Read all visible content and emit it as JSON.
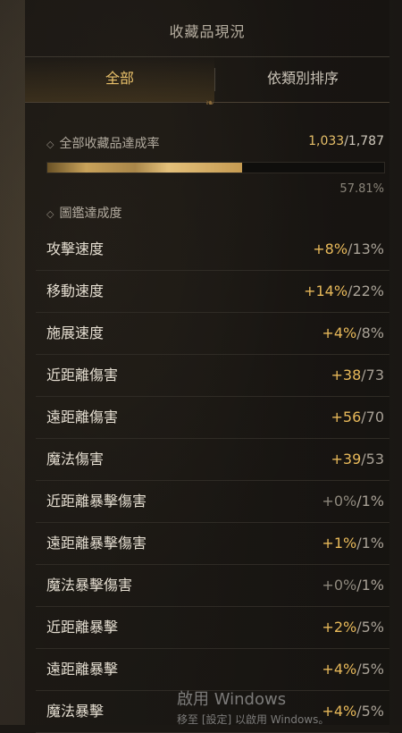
{
  "title": "收藏品現況",
  "tabs": [
    {
      "label": "全部",
      "active": true
    },
    {
      "label": "依類別排序",
      "active": false
    }
  ],
  "overall": {
    "label": "全部收藏品達成率",
    "current": "1,033",
    "total": "1,787",
    "percent_text": "57.81%",
    "percent": 57.81
  },
  "codex": {
    "label": "圖鑑達成度"
  },
  "stats": [
    {
      "name": "攻擊速度",
      "bonus": "+8%",
      "max": "13%"
    },
    {
      "name": "移動速度",
      "bonus": "+14%",
      "max": "22%"
    },
    {
      "name": "施展速度",
      "bonus": "+4%",
      "max": "8%"
    },
    {
      "name": "近距離傷害",
      "bonus": "+38",
      "max": "73"
    },
    {
      "name": "遠距離傷害",
      "bonus": "+56",
      "max": "70"
    },
    {
      "name": "魔法傷害",
      "bonus": "+39",
      "max": "53"
    },
    {
      "name": "近距離暴擊傷害",
      "bonus": "+0%",
      "max": "1%",
      "zero": true
    },
    {
      "name": "遠距離暴擊傷害",
      "bonus": "+1%",
      "max": "1%"
    },
    {
      "name": "魔法暴擊傷害",
      "bonus": "+0%",
      "max": "1%",
      "zero": true
    },
    {
      "name": "近距離暴擊",
      "bonus": "+2%",
      "max": "5%"
    },
    {
      "name": "遠距離暴擊",
      "bonus": "+4%",
      "max": "5%"
    },
    {
      "name": "魔法暴擊",
      "bonus": "+4%",
      "max": "5%"
    }
  ],
  "watermark": {
    "line1": "啟用 Windows",
    "line2": "移至 [設定] 以啟用 Windows。"
  },
  "colors": {
    "accent": "#e8c06a",
    "bonus": "#e8b95a"
  }
}
